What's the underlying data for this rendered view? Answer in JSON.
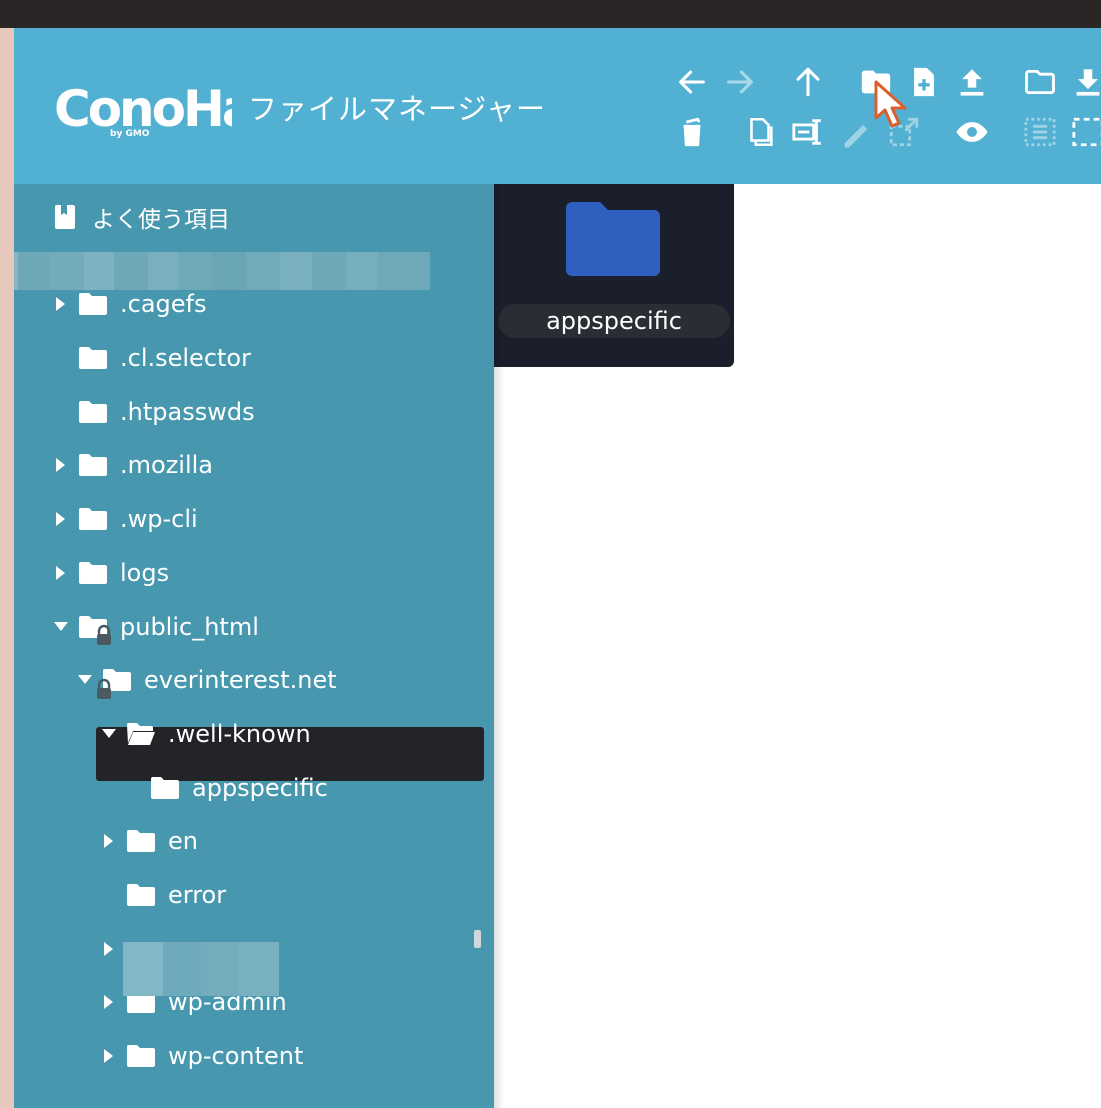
{
  "app": {
    "logo_text": "ConoHa",
    "logo_sub": "by GMO",
    "title": "ファイルマネージャー"
  },
  "toolbar": {
    "row1": [
      {
        "name": "back-icon",
        "enabled": true
      },
      {
        "name": "forward-icon",
        "enabled": false
      },
      {
        "name": "up-icon",
        "enabled": true
      },
      {
        "name": "new-folder-icon",
        "enabled": true
      },
      {
        "name": "new-file-icon",
        "enabled": true
      },
      {
        "name": "upload-icon",
        "enabled": true
      },
      {
        "name": "open-folder-icon",
        "enabled": true
      },
      {
        "name": "download-icon",
        "enabled": true
      }
    ],
    "row2": [
      {
        "name": "delete-icon",
        "enabled": true
      },
      {
        "name": "copy-icon",
        "enabled": true
      },
      {
        "name": "rename-icon",
        "enabled": true
      },
      {
        "name": "edit-icon",
        "enabled": false
      },
      {
        "name": "resize-icon",
        "enabled": false
      },
      {
        "name": "preview-icon",
        "enabled": true
      },
      {
        "name": "select-all-icon",
        "enabled": false
      },
      {
        "name": "select-none-icon",
        "enabled": true
      }
    ]
  },
  "sidebar": {
    "favorites_label": "よく使う項目",
    "tree": [
      {
        "label": ".cagefs",
        "expandable": true,
        "expanded": false,
        "level": 0
      },
      {
        "label": ".cl.selector",
        "expandable": false,
        "level": 0
      },
      {
        "label": ".htpasswds",
        "expandable": false,
        "level": 0
      },
      {
        "label": ".mozilla",
        "expandable": true,
        "expanded": false,
        "level": 0
      },
      {
        "label": ".wp-cli",
        "expandable": true,
        "expanded": false,
        "level": 0
      },
      {
        "label": "logs",
        "expandable": true,
        "expanded": false,
        "level": 0,
        "locked": true
      },
      {
        "label": "public_html",
        "expandable": true,
        "expanded": true,
        "level": 0,
        "locked": true
      },
      {
        "label": "everinterest.net",
        "expandable": true,
        "expanded": true,
        "level": 1
      },
      {
        "label": ".well-known",
        "expandable": true,
        "expanded": true,
        "level": 2,
        "selected": true
      },
      {
        "label": "appspecific",
        "expandable": false,
        "level": 3
      },
      {
        "label": "en",
        "expandable": true,
        "expanded": false,
        "level": 2
      },
      {
        "label": "error",
        "expandable": false,
        "level": 2
      },
      {
        "label": "",
        "expandable": true,
        "expanded": false,
        "level": 2,
        "redacted": true
      },
      {
        "label": "wp-admin",
        "expandable": true,
        "expanded": false,
        "level": 2
      },
      {
        "label": "wp-content",
        "expandable": true,
        "expanded": false,
        "level": 2
      }
    ]
  },
  "content": {
    "items": [
      {
        "label": "appspecific",
        "type": "folder"
      }
    ]
  },
  "colors": {
    "header": "#52b1d3",
    "sidebar": "#4798af",
    "selected": "#232428",
    "folder_icon": "#2f5fbf"
  }
}
